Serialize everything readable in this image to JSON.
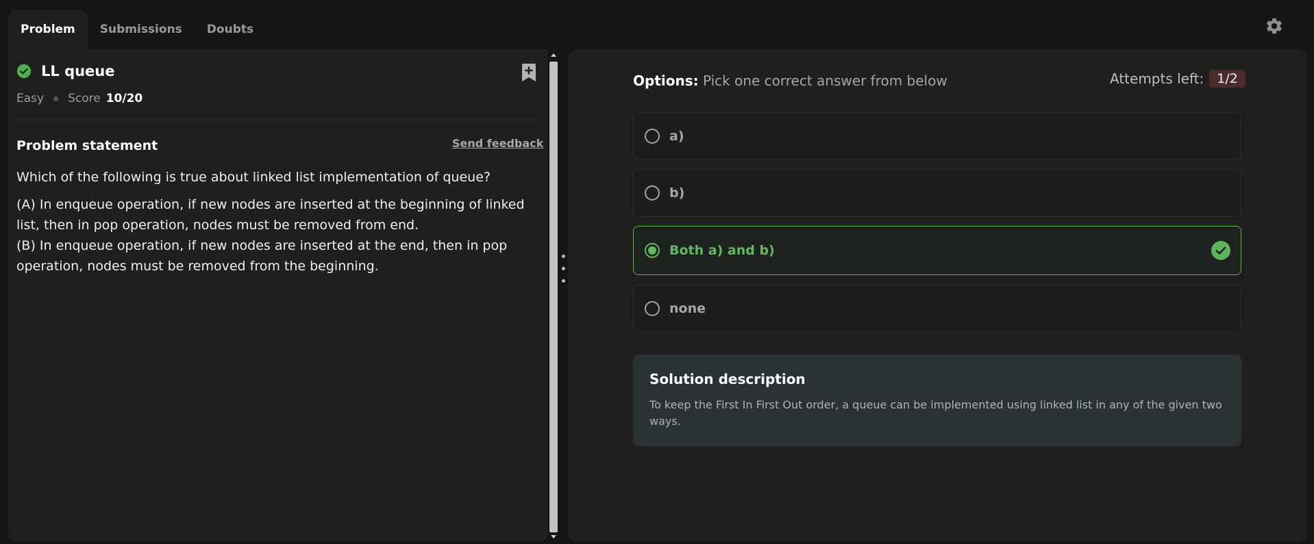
{
  "tabs": [
    {
      "label": "Problem",
      "active": true
    },
    {
      "label": "Submissions",
      "active": false
    },
    {
      "label": "Doubts",
      "active": false
    }
  ],
  "icons": {
    "settings": "gear-icon",
    "solved": "check-circle-icon",
    "bookmark": "bookmark-add-icon",
    "correct": "check-circle-icon"
  },
  "problem": {
    "title": "LL queue",
    "difficulty": "Easy",
    "score_label": "Score",
    "score_value": "10/20",
    "statement_heading": "Problem statement",
    "feedback_label": "Send feedback",
    "question": "Which of the following is true about linked list implementation of queue?",
    "option_a_text": "(A) In enqueue operation, if new nodes are inserted at the beginning of linked list, then in pop operation, nodes must be removed from end.",
    "option_b_text": "(B) In enqueue operation, if new nodes are inserted at the end, then in pop operation, nodes must be removed from the beginning."
  },
  "options_panel": {
    "heading_bold": "Options:",
    "heading_rest": "Pick one correct answer from below",
    "attempts_label": "Attempts left:",
    "attempts_value": "1/2",
    "options": [
      {
        "label": "a)",
        "selected": false
      },
      {
        "label": "b)",
        "selected": false
      },
      {
        "label": "Both a) and b)",
        "selected": true,
        "correct": true
      },
      {
        "label": "none",
        "selected": false
      }
    ]
  },
  "solution": {
    "title": "Solution description",
    "text": "To keep the First In First Out order, a queue can be implemented using linked list in any of the given two ways."
  },
  "colors": {
    "accent_green": "#62b862",
    "attempts_badge": "#4b2c2e",
    "solution_bg": "#2a3234",
    "panel_bg": "#1f1f1f"
  }
}
